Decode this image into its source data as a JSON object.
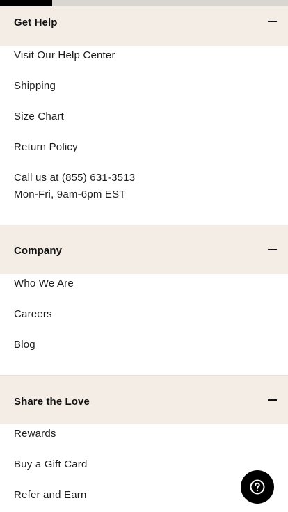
{
  "progress": {
    "fraction": 0.18
  },
  "sections": [
    {
      "title": "Get Help",
      "links": [
        "Visit Our Help Center",
        "Shipping",
        "Size Chart",
        "Return Policy"
      ],
      "contact": {
        "phone": "Call us at (855) 631-3513",
        "hours": "Mon-Fri, 9am-6pm EST"
      }
    },
    {
      "title": "Company",
      "links": [
        "Who We Are",
        "Careers",
        "Blog"
      ]
    },
    {
      "title": "Share the Love",
      "links": [
        "Rewards",
        "Buy a Gift Card",
        "Refer and Earn"
      ]
    }
  ],
  "icons": {
    "collapse": "minus-icon",
    "help": "question-mark-icon"
  },
  "colors": {
    "header_bg": "#f3ede6",
    "accent": "#000000",
    "progress_track": "#d9d6d2"
  }
}
